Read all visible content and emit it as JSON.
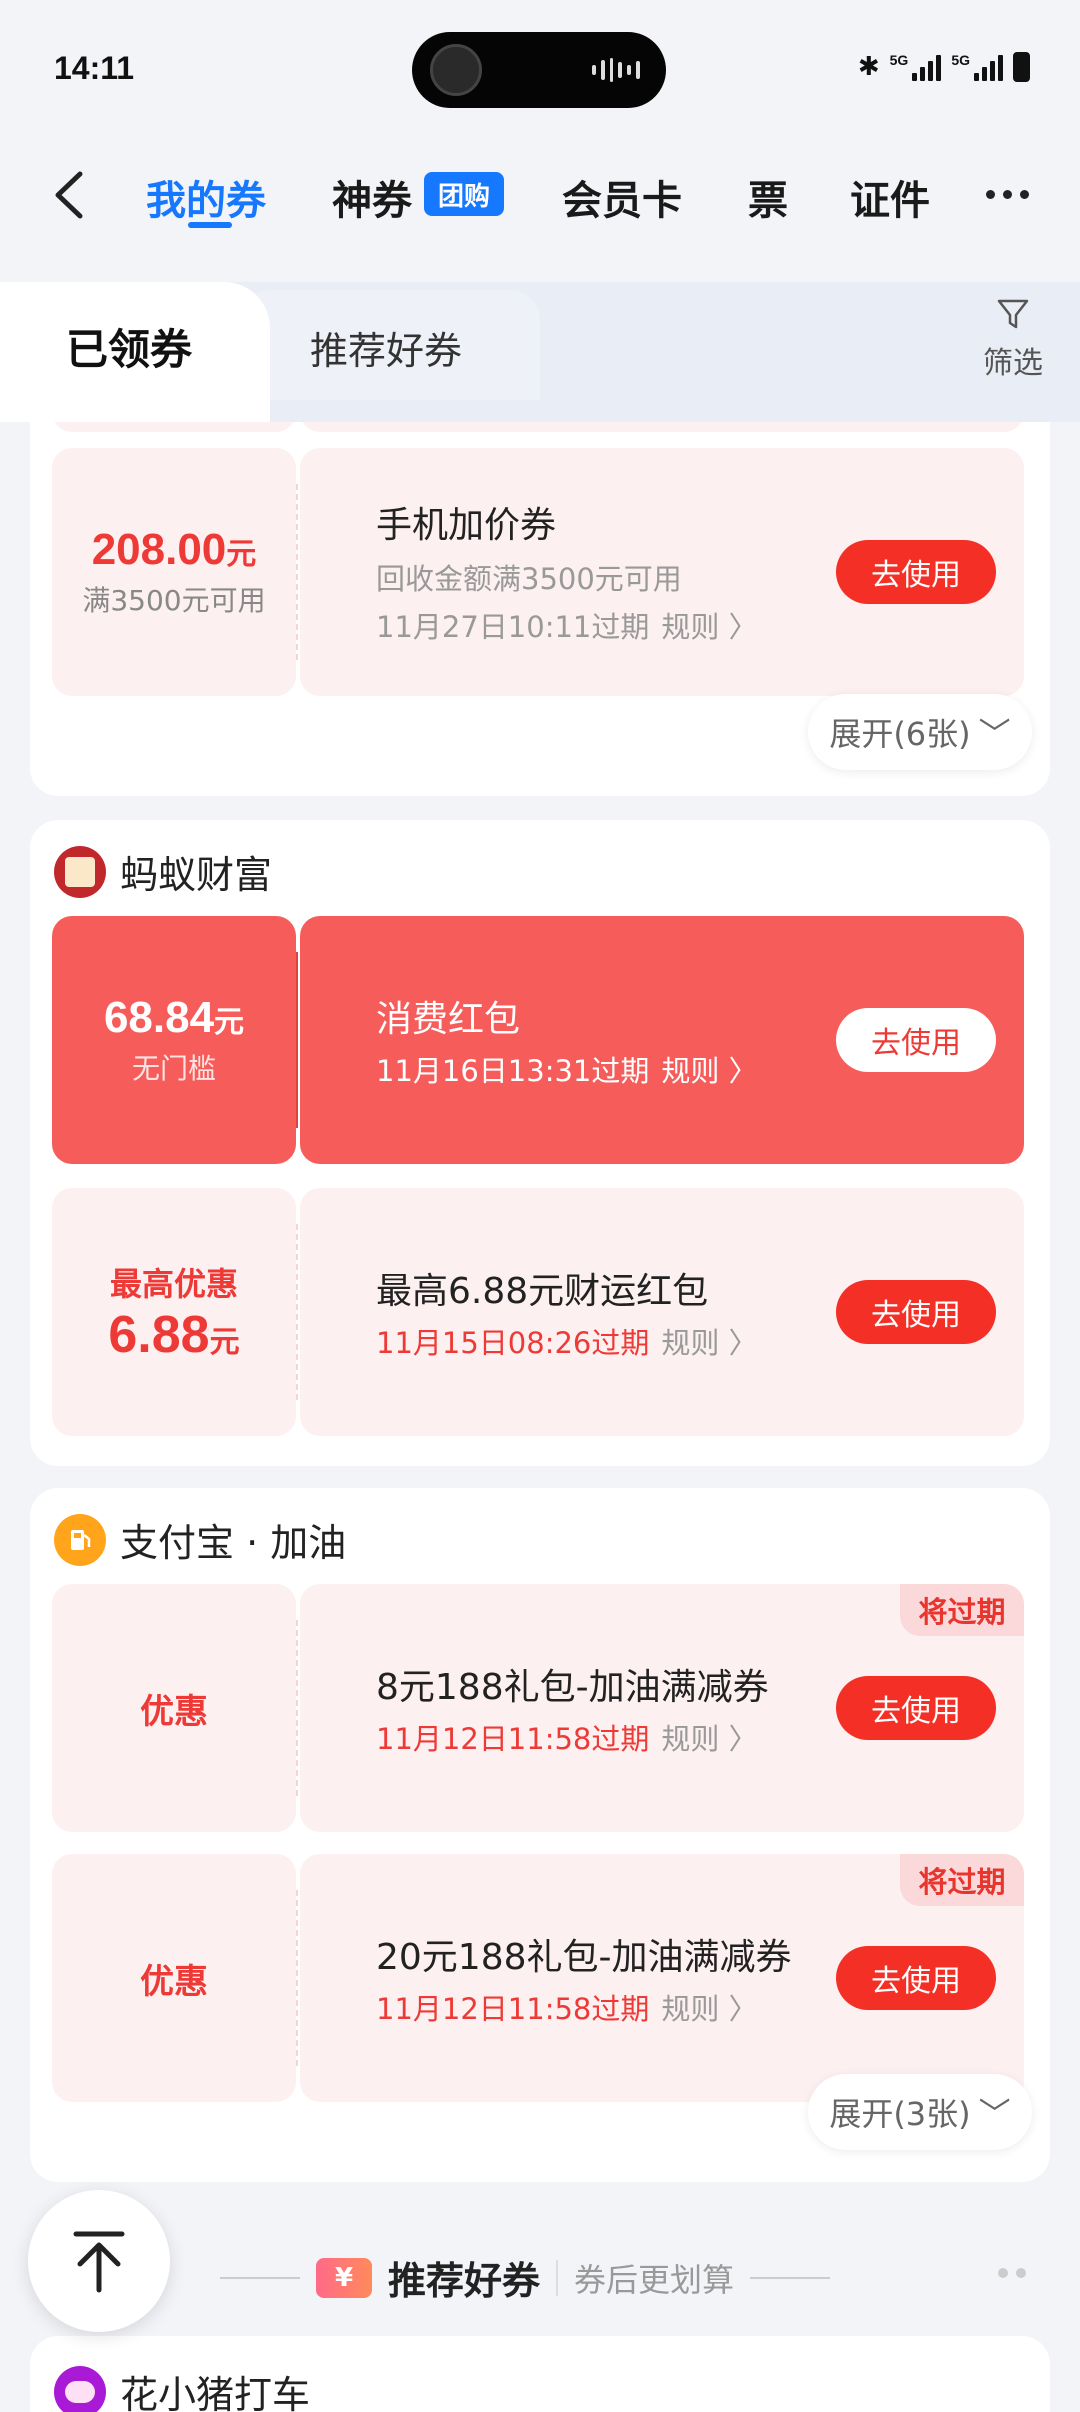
{
  "status_bar": {
    "time": "14:11",
    "network1": "5G",
    "network2": "5G"
  },
  "nav": {
    "tabs": [
      {
        "label": "我的券"
      },
      {
        "label": "神券"
      },
      {
        "label": "会员卡"
      },
      {
        "label": "票"
      },
      {
        "label": "证件"
      }
    ],
    "tuangou_badge": "团购"
  },
  "subtabs": {
    "received": "已领券",
    "recommended": "推荐好券"
  },
  "filter_label": "筛选",
  "groups": {
    "g1": {
      "coupon": {
        "amount": "208.00",
        "unit": "元",
        "condition": "满3500元可用",
        "title": "手机加价券",
        "desc": "回收金额满3500元可用",
        "expiry": "11月27日10:11过期",
        "rule": "规则",
        "button": "去使用"
      },
      "expand": "展开(6张)"
    },
    "g2": {
      "merchant": "蚂蚁财富",
      "coupon1": {
        "amount": "68.84",
        "unit": "元",
        "condition": "无门槛",
        "title": "消费红包",
        "expiry": "11月16日13:31过期",
        "rule": "规则",
        "button": "去使用"
      },
      "coupon2": {
        "prefix": "最高优惠",
        "amount": "6.88",
        "unit": "元",
        "title": "最高6.88元财运红包",
        "expiry": "11月15日08:26过期",
        "rule": "规则",
        "button": "去使用"
      }
    },
    "g3": {
      "merchant": "支付宝 · 加油",
      "coupon1": {
        "left_label": "优惠",
        "title": "8元188礼包-加油满减券",
        "expiry": "11月12日11:58过期",
        "rule": "规则",
        "button": "去使用",
        "tag": "将过期"
      },
      "coupon2": {
        "left_label": "优惠",
        "title": "20元188礼包-加油满减券",
        "expiry": "11月12日11:58过期",
        "rule": "规则",
        "button": "去使用",
        "tag": "将过期"
      },
      "expand": "展开(3张)"
    },
    "g4": {
      "merchant": "花小猪打车"
    }
  },
  "recommend": {
    "icon": "¥",
    "title": "推荐好券",
    "subtitle": "券后更划算"
  },
  "colors": {
    "accent": "#1677ff",
    "red": "#f42f25",
    "red_card": "#f55c5a",
    "pink_bg": "#fdf0f1"
  }
}
